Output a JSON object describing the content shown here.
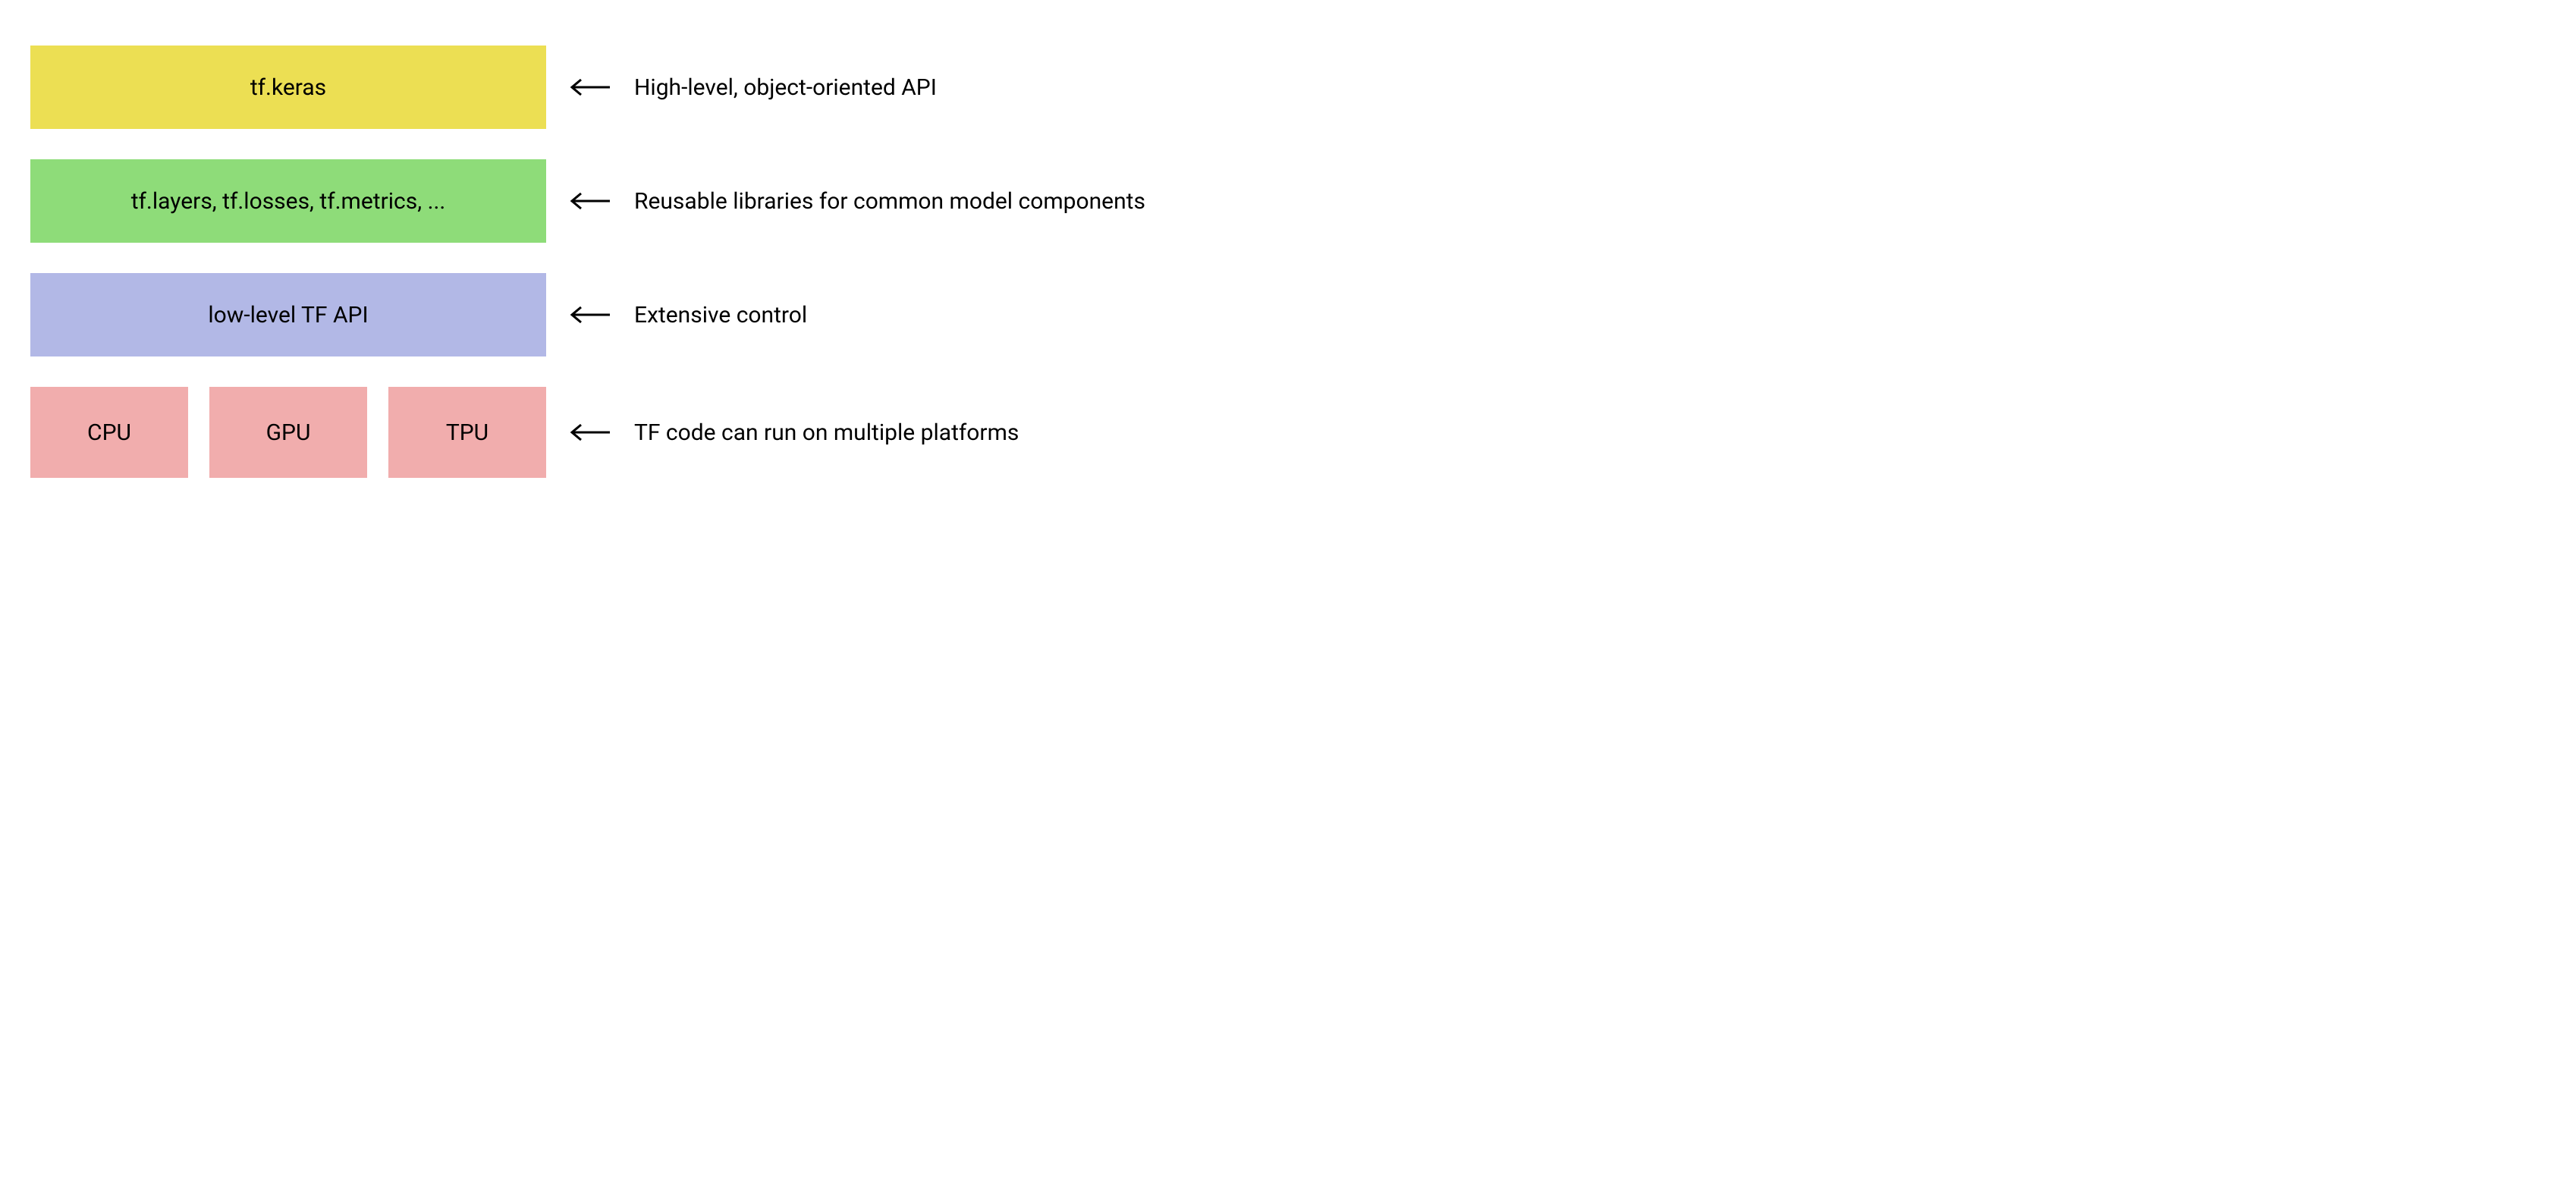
{
  "layers": [
    {
      "label": "tf.keras",
      "description": "High-level, object-oriented API",
      "color": "yellow"
    },
    {
      "label": "tf.layers, tf.losses, tf.metrics, ...",
      "description": "Reusable libraries for common model components",
      "color": "green"
    },
    {
      "label": "low-level TF API",
      "description": "Extensive control",
      "color": "purple"
    }
  ],
  "hardware": {
    "items": [
      "CPU",
      "GPU",
      "TPU"
    ],
    "description": "TF code can run on multiple platforms",
    "color": "pink"
  }
}
